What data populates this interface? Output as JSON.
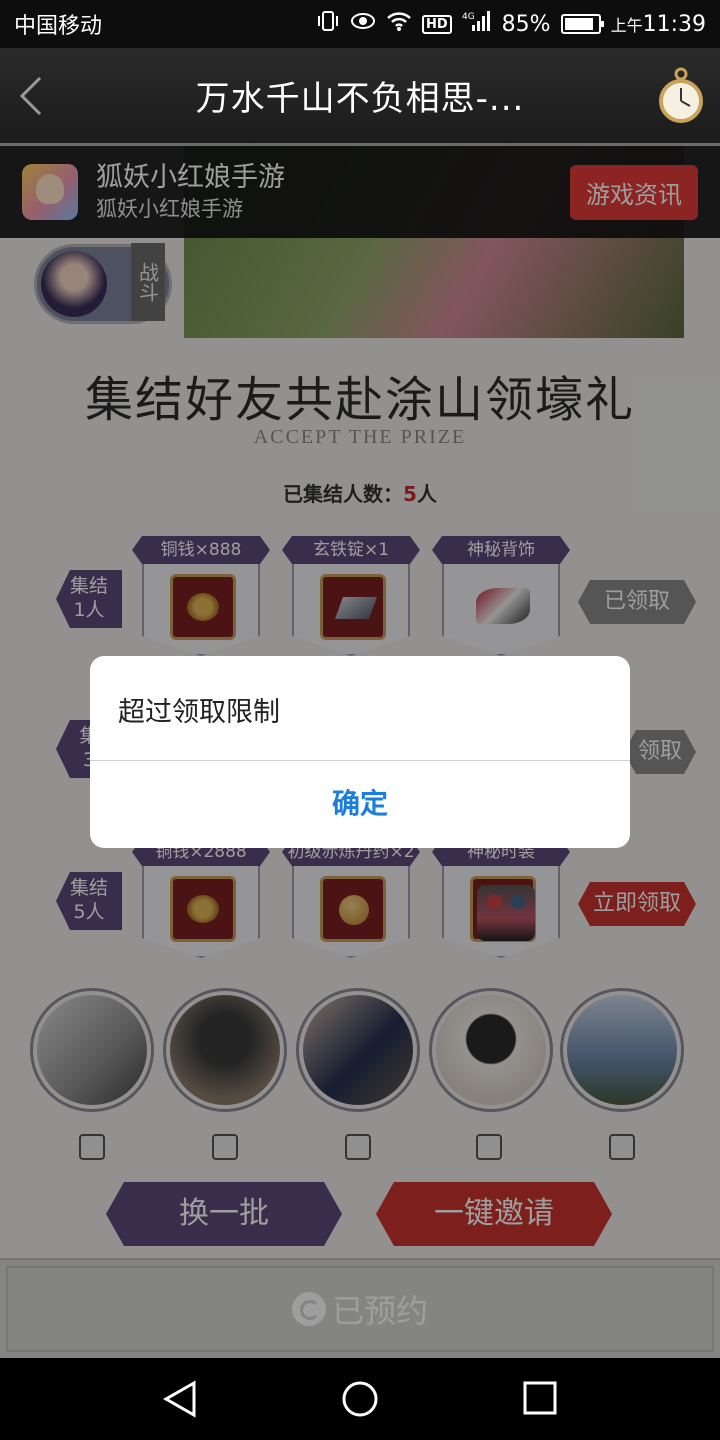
{
  "status_bar": {
    "carrier": "中国移动",
    "network": "4G",
    "hd": "HD",
    "battery": "85%",
    "ampm": "上午",
    "time": "11:39"
  },
  "nav": {
    "title": "万水千山不负相思-..."
  },
  "game_banner": {
    "name": "狐妖小红娘手游",
    "subtitle": "狐妖小红娘手游",
    "button": "游戏资讯"
  },
  "badge": {
    "tag": "战斗"
  },
  "event": {
    "heading": "集结好友共赴涂山领壕礼",
    "subheading": "ACCEPT THE PRIZE",
    "gathered_label": "已集结人数：",
    "gathered_count": "5",
    "gathered_unit": "人"
  },
  "rows": [
    {
      "tier_line1": "集结",
      "tier_line2": "1人",
      "items": [
        {
          "label": "铜钱×888",
          "icon": "coins-icon"
        },
        {
          "label": "玄铁锭×1",
          "icon": "iron-ingot-icon"
        },
        {
          "label": "神秘背饰",
          "icon": "back-ornament-icon"
        }
      ],
      "claim": "已领取",
      "claim_state": "claimed"
    },
    {
      "tier_line1": "集",
      "tier_line2": "3",
      "items": [],
      "claim": "领取",
      "claim_state": "claimed"
    },
    {
      "tier_line1": "集结",
      "tier_line2": "5人",
      "items": [
        {
          "label": "铜钱×2888",
          "icon": "coins-icon"
        },
        {
          "label": "初级赤炼丹药×2",
          "icon": "pill-icon"
        },
        {
          "label": "神秘时装",
          "icon": "costume-icon"
        }
      ],
      "claim": "立即领取",
      "claim_state": "available"
    }
  ],
  "buttons": {
    "refresh": "换一批",
    "invite": "一键邀请"
  },
  "footer": {
    "reserved": "已预约"
  },
  "dialog": {
    "message": "超过领取限制",
    "confirm": "确定"
  },
  "colors": {
    "purple": "#5b4a7a",
    "red": "#c8332f",
    "link_blue": "#1a7de0"
  }
}
